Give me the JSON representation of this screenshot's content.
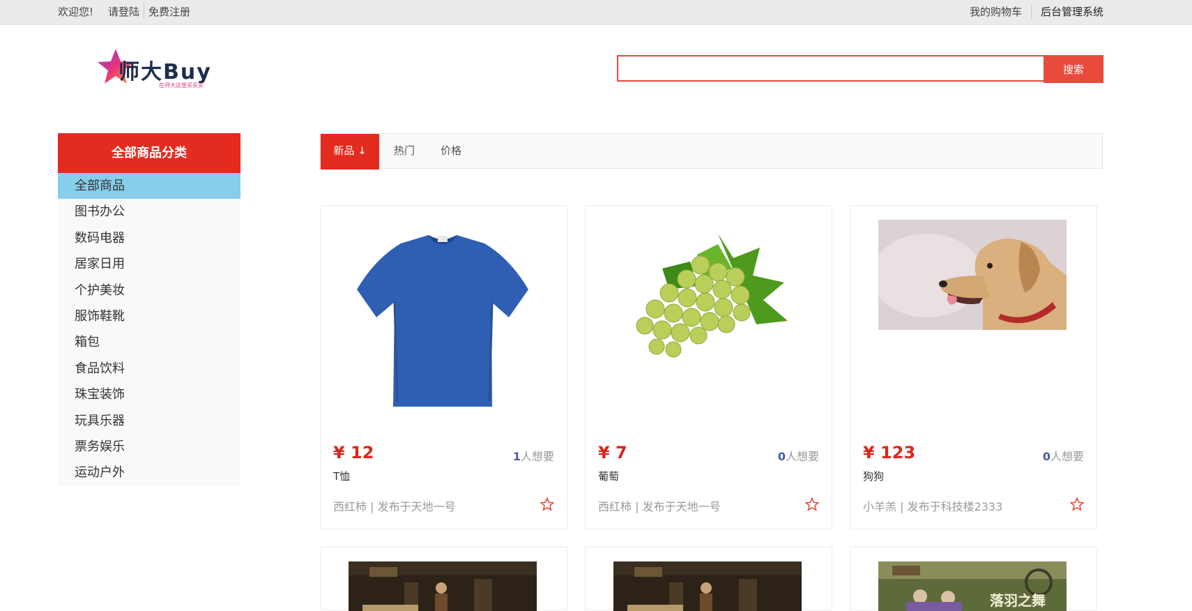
{
  "topbar": {
    "welcome": "欢迎您!",
    "login": "请登陆",
    "register": "免费注册",
    "cart": "我的购物车",
    "admin": "后台管理系统"
  },
  "logo": {
    "text": "师大Buy",
    "slogan": "在师大这里买买买"
  },
  "search": {
    "placeholder": "",
    "button": "搜索"
  },
  "sidebar": {
    "title": "全部商品分类",
    "items": [
      "全部商品",
      "图书办公",
      "数码电器",
      "居家日用",
      "个护美妆",
      "服饰鞋靴",
      "箱包",
      "食品饮料",
      "珠宝装饰",
      "玩具乐器",
      "票务娱乐",
      "运动户外"
    ],
    "active_index": 0
  },
  "sort": {
    "tabs": [
      {
        "label": "新品 ↓",
        "active": true
      },
      {
        "label": "热门",
        "active": false
      },
      {
        "label": "价格",
        "active": false
      }
    ]
  },
  "products": [
    {
      "price": "¥ 12",
      "wants": "1",
      "wants_suffix": "人想要",
      "name": "T恤",
      "meta": "西红柿 | 发布于天地一号",
      "image": "blue-tshirt"
    },
    {
      "price": "¥ 7",
      "wants": "0",
      "wants_suffix": "人想要",
      "name": "葡萄",
      "meta": "西红柿 | 发布于天地一号",
      "image": "green-grapes"
    },
    {
      "price": "¥ 123",
      "wants": "0",
      "wants_suffix": "人想要",
      "name": "狗狗",
      "meta": "小羊羔 | 发布于科技楼2333",
      "image": "labrador-dog"
    },
    {
      "image": "game-scene"
    },
    {
      "image": "game-scene"
    },
    {
      "image": "game-scene-forest",
      "image_text": "落羽之舞"
    }
  ],
  "colors": {
    "accent_red": "#e42b1f",
    "search_red": "#e84a3b",
    "active_category": "#87ceeb",
    "price_red": "#d8271c",
    "wants_blue": "#4a5aa8"
  }
}
